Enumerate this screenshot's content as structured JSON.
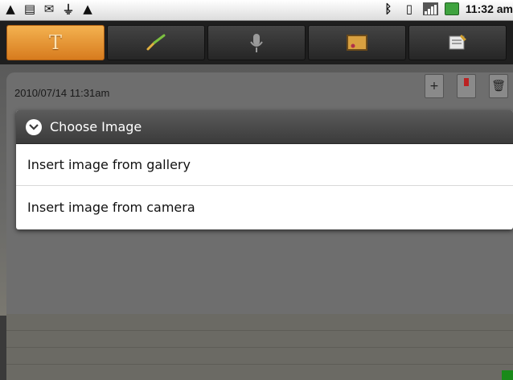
{
  "statusbar": {
    "left_icons": [
      "warning-icon",
      "message-icon",
      "mail-icon",
      "usb-icon",
      "warning-icon"
    ],
    "right_icons": [
      "bluetooth-icon",
      "phone-icon",
      "signal-icon",
      "battery-icon"
    ],
    "time": "11:32 am"
  },
  "tabs": [
    {
      "name": "text",
      "label": "T",
      "icon": "text-icon",
      "active": true
    },
    {
      "name": "draw",
      "icon": "brush-icon",
      "active": false
    },
    {
      "name": "voice",
      "icon": "microphone-icon",
      "active": false
    },
    {
      "name": "image",
      "icon": "picture-icon",
      "active": false
    },
    {
      "name": "note",
      "icon": "notepad-icon",
      "active": false
    }
  ],
  "note": {
    "timestamp": "2010/07/14  11:31am",
    "actions": [
      "add-page-icon",
      "bookmark-icon",
      "trash-icon"
    ]
  },
  "dialog": {
    "title": "Choose Image",
    "items": [
      "Insert image from gallery",
      "Insert image from camera"
    ]
  },
  "colors": {
    "active_tab": "#e5922f",
    "dialog_title_bg": "#4a4a4a"
  }
}
